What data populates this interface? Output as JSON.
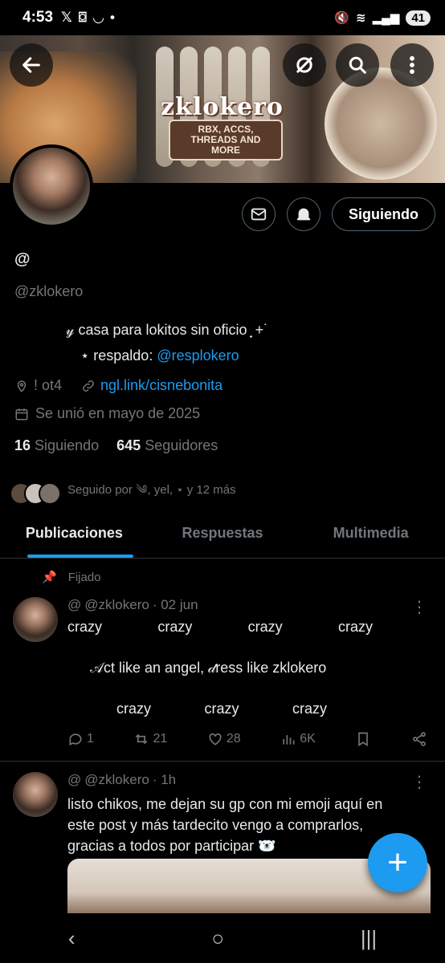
{
  "status_bar": {
    "time": "4:53",
    "left_icons": [
      "x-logo-icon",
      "scan-icon",
      "tiktok-shop-icon",
      "dot-icon"
    ],
    "right_icons": [
      "mute-icon",
      "wifi-icon",
      "signal-icon"
    ],
    "battery": "41"
  },
  "banner": {
    "brand": "zklokero",
    "tagline": "RBX, ACCS, THREADS AND MORE"
  },
  "profile": {
    "name_icon": "threads-icon",
    "handle": "@zklokero",
    "bio_line1": "𝓎 casa para lokitos sin oficio ̟ +˙",
    "bio_line2_prefix": "⋆ respaldo: ",
    "bio_line2_link": "@resplokero",
    "location": "! ot4",
    "website": "ngl.link/cisnebonita",
    "joined": "Se unió en mayo de 2025",
    "following_count": "16",
    "following_label": "Siguiendo",
    "followers_count": "645",
    "followers_label": "Seguidores",
    "followed_by": "Seguido por ༄, yel, ⋆ y 12 más"
  },
  "actions": {
    "follow_label": "Siguiendo"
  },
  "tabs": [
    "Publicaciones",
    "Respuestas",
    "Multimedia"
  ],
  "pinned_label": "Fijado",
  "posts": [
    {
      "handle": "@zklokero",
      "time": "· 02 jun",
      "line1": [
        "crazy",
        "crazy",
        "crazy",
        "crazy"
      ],
      "line2": "𝒜ct like an angel, 𝒹ress like zklokero",
      "line3": [
        "crazy",
        "crazy",
        "crazy"
      ],
      "replies": "1",
      "reposts": "21",
      "likes": "28",
      "views": "6K"
    },
    {
      "handle": "@zklokero",
      "time": "· 1h",
      "text_l1": "listo chikos, me dejan su gp con mi emoji aquí en",
      "text_l2": "este post y más tardecito vengo a comprarlos,",
      "text_l3": "gracias a todos por participar 🐻‍❄️"
    }
  ],
  "fab": "+"
}
